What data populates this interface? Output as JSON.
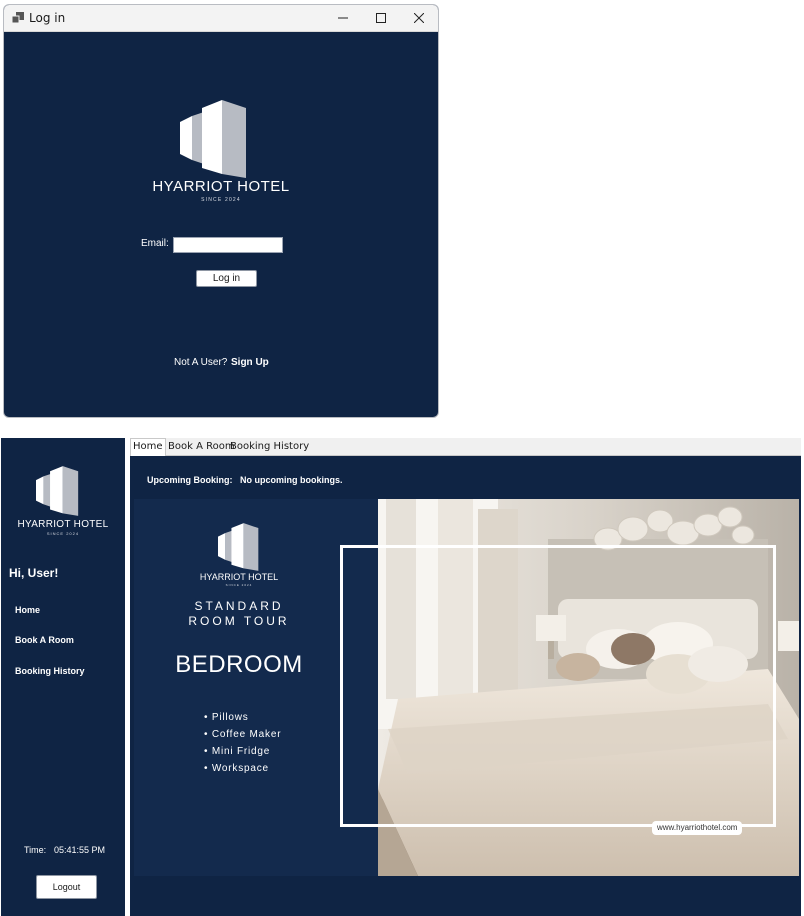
{
  "login_window": {
    "title": "Log in",
    "brand": "HYARRIOT HOTEL",
    "since": "SINCE 2024",
    "email_label": "Email:",
    "email_value": "",
    "login_button": "Log in",
    "not_user_text": "Not A User?",
    "signup_link": "Sign Up"
  },
  "main_app": {
    "tabs": [
      "Home",
      "Book A Room",
      "Booking History"
    ],
    "active_tab": "Home",
    "sidebar": {
      "brand": "HYARRIOT HOTEL",
      "since": "SINCE 2024",
      "greeting": "Hi, User!",
      "nav": [
        "Home",
        "Book A Room",
        "Booking History"
      ],
      "time_label": "Time:",
      "time_value": "05:41:55 PM",
      "logout_button": "Logout"
    },
    "upcoming": {
      "label": "Upcoming Booking:",
      "value": "No upcoming bookings."
    },
    "tour": {
      "brand": "HYARRIOT HOTEL",
      "since": "SINCE 2024",
      "title_line1": "STANDARD",
      "title_line2": "ROOM TOUR",
      "room": "BEDROOM",
      "amenities": [
        "• Pillows",
        "• Coffee Maker",
        "• Mini Fridge",
        "• Workspace"
      ],
      "website": "www.hyarriothotel.com"
    }
  },
  "colors": {
    "navy": "#0f2444",
    "logo_gray": "#b7bbc3",
    "white": "#ffffff"
  },
  "icons": [
    "app-icon",
    "minimize-icon",
    "maximize-icon",
    "close-icon",
    "hotel-logo-icon"
  ]
}
